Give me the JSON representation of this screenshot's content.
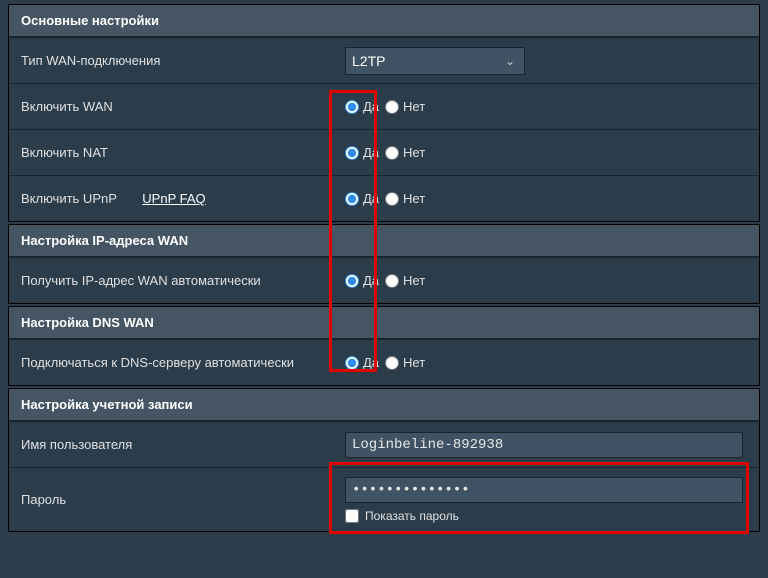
{
  "sections": {
    "main": "Основные настройки",
    "ipwan": "Настройка IP-адреса WAN",
    "dnswan": "Настройка DNS WAN",
    "account": "Настройка учетной записи"
  },
  "labels": {
    "wanType": "Тип WAN-подключения",
    "enableWan": "Включить WAN",
    "enableNat": "Включить NAT",
    "enableUpnp": "Включить UPnP",
    "upnpFaq": "UPnP  FAQ",
    "getIpAuto": "Получить IP-адрес WAN автоматически",
    "dnsAuto": "Подключаться к DNS-серверу автоматически",
    "username": "Имя пользователя",
    "password": "Пароль",
    "showPassword": "Показать пароль"
  },
  "radio": {
    "yes": "Да",
    "no": "Нет"
  },
  "wanType": {
    "value": "L2TP"
  },
  "accountValues": {
    "username": "Loginbeline-892938",
    "password": "••••••••••••••"
  }
}
